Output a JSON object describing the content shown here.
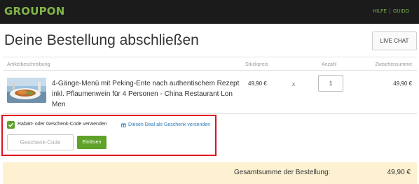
{
  "header": {
    "logo": "GROUPON",
    "nav": [
      "HILFE",
      "GUIDO"
    ]
  },
  "page": {
    "title": "Deine Bestellung abschließen",
    "live_chat_label": "LIVE CHAT"
  },
  "cart": {
    "columns": {
      "description": "Artikelbeschreibung",
      "unit_price": "Stückpreis",
      "quantity": "Anzahl",
      "subtotal": "Zwischensumme"
    },
    "item": {
      "description": "4-Gänge-Menü mit Peking-Ente nach authentischem Rezept inkl. Pflaumenwein für 4 Personen - China Restaurant Lon Men",
      "unit_price": "49,90 €",
      "times": "x",
      "quantity": "1",
      "subtotal": "49,90 €"
    }
  },
  "coupon": {
    "checkbox_label": "Rabatt- oder Geschenk-Code verwenden",
    "checked": true,
    "gift_link": "Diesen Deal als Geschenk versenden",
    "input_placeholder": "Geschenk-Code",
    "redeem_button": "Einlösen",
    "highlight_color": "#e0111f"
  },
  "total": {
    "label": "Gesamtsumme der Bestellung:",
    "value": "49,90 €"
  },
  "colors": {
    "brand_green": "#82b548",
    "button_green": "#5fa22a",
    "total_bg": "#fdf1d2",
    "link_blue": "#2a7ab8"
  }
}
